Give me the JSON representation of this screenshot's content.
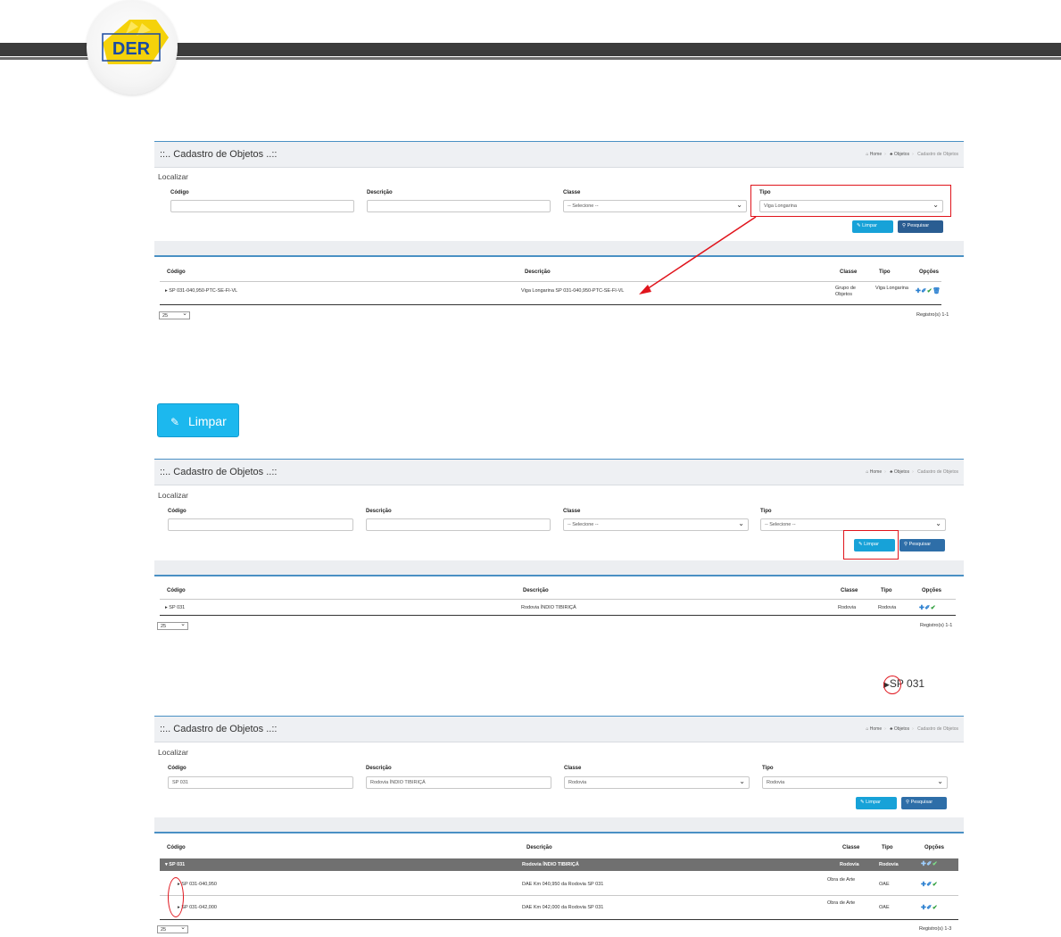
{
  "logo": {
    "text": "DER",
    "colors": {
      "yellow": "#f5d20a",
      "blue": "#1a4aa0"
    }
  },
  "breadcrumb": {
    "home": "Home",
    "objetos": "Objetos",
    "current": "Cadastro de Objetos"
  },
  "labels": {
    "title": "::.. Cadastro de Objetos ..::",
    "localizar": "Localizar",
    "codigo": "Código",
    "descricao": "Descrição",
    "classe": "Classe",
    "tipo": "Tipo",
    "opcoes": "Opções",
    "limpar": "Limpar",
    "pesquisar": "Pesquisar",
    "page_size": "25",
    "selecione": "-- Selecione --"
  },
  "screen1": {
    "fields": {
      "codigo": "",
      "descricao": "",
      "classe": "-- Selecione --",
      "tipo": "Viga Longarina"
    },
    "rows": [
      {
        "codigo": "SP 031-040,950-PTC-SE-FI-VL",
        "descricao": "Viga Longarina SP 031-040,950-PTC-SE-FI-VL",
        "classe": "Grupo de Objetos",
        "tipo": "Viga Longarina"
      }
    ],
    "registro": "Registro(s) 1-1"
  },
  "big_button": {
    "label": "Limpar"
  },
  "screen2": {
    "fields": {
      "codigo": "",
      "descricao": "",
      "classe": "-- Selecione --",
      "tipo": "-- Selecione --"
    },
    "rows": [
      {
        "codigo": "SP 031",
        "descricao": "Rodovia ÍNDIO TIBIRIÇÁ",
        "classe": "Rodovia",
        "tipo": "Rodovia"
      }
    ],
    "registro": "Registro(s) 1-1"
  },
  "snippet": {
    "text": "SP 031"
  },
  "screen3": {
    "fields": {
      "codigo": "SP 031",
      "descricao": "Rodovia ÍNDIO TIBIRIÇÁ",
      "classe": "Rodovia",
      "tipo": "Rodovia"
    },
    "group_row": {
      "codigo": "SP 031",
      "descricao": "Rodovia ÍNDIO TIBIRIÇÁ",
      "classe": "Rodovia",
      "tipo": "Rodovia"
    },
    "rows": [
      {
        "codigo": "SP 031-040,950",
        "descricao": "DAE Km 040,950 da Rodovia SP 031",
        "classe": "Obra de Arte",
        "tipo": "OAE"
      },
      {
        "codigo": "SP 031-042,000",
        "descricao": "DAE Km 042,000 da Rodovia SP 031",
        "classe": "Obra de Arte",
        "tipo": "OAE"
      }
    ],
    "registro": "Registro(s) 1-3"
  }
}
